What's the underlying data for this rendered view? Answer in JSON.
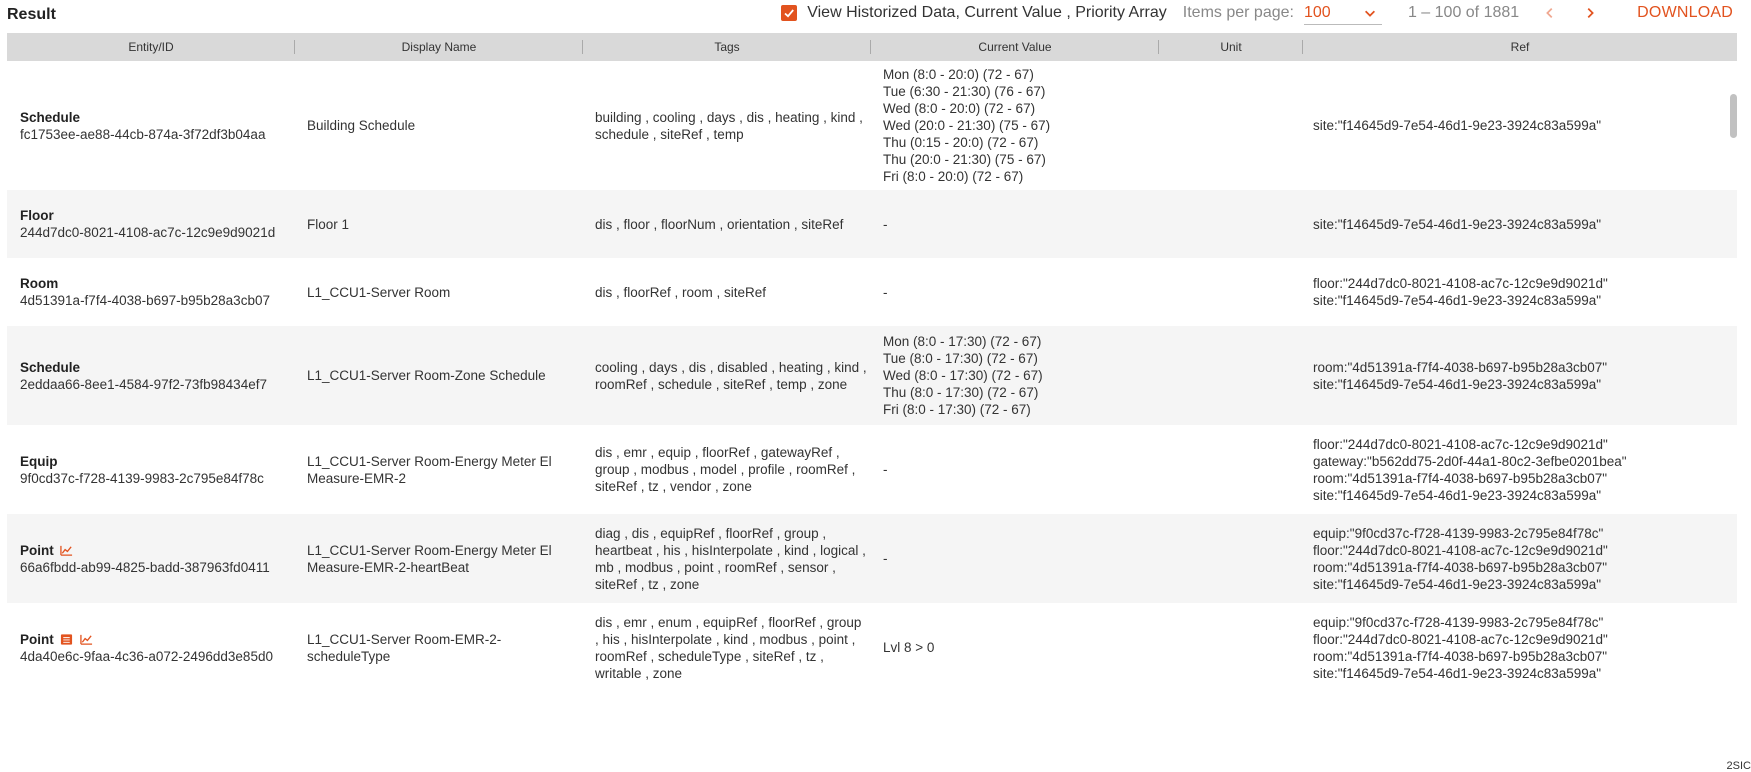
{
  "header": {
    "title": "Result",
    "historized_label": "View Historized Data, Current Value , Priority Array",
    "historized_checked": true,
    "items_per_page_label": "Items per page:",
    "items_per_page_value": "100",
    "range_text": "1 – 100 of 1881",
    "download_label": "DOWNLOAD",
    "accent_color": "#e2531f"
  },
  "table": {
    "columns": [
      "Entity/ID",
      "Display Name",
      "Tags",
      "Current Value",
      "Unit",
      "Ref"
    ],
    "rows": [
      {
        "type": "Schedule",
        "id": "fc1753ee-ae88-44cb-874a-3f72df3b04aa",
        "icons": [],
        "display": "Building Schedule",
        "tags": "building , cooling , days , dis , heating , kind , schedule , siteRef , temp",
        "current": [
          "Mon (8:0 - 20:0) (72 - 67)",
          "Tue (6:30 - 21:30) (76 - 67)",
          "Wed (8:0 - 20:0) (72 - 67)",
          "Wed (20:0 - 21:30) (75 - 67)",
          "Thu (0:15 - 20:0) (72 - 67)",
          "Thu (20:0 - 21:30) (75 - 67)",
          "Fri (8:0 - 20:0) (72 - 67)"
        ],
        "unit": "",
        "refs": [
          "site:\"f14645d9-7e54-46d1-9e23-3924c83a599a\""
        ]
      },
      {
        "type": "Floor",
        "id": "244d7dc0-8021-4108-ac7c-12c9e9d9021d",
        "icons": [],
        "display": "Floor 1",
        "tags": "dis , floor , floorNum , orientation , siteRef",
        "current": [
          "-"
        ],
        "unit": "",
        "refs": [
          "site:\"f14645d9-7e54-46d1-9e23-3924c83a599a\""
        ]
      },
      {
        "type": "Room",
        "id": "4d51391a-f7f4-4038-b697-b95b28a3cb07",
        "icons": [],
        "display": "L1_CCU1-Server Room",
        "tags": "dis , floorRef , room , siteRef",
        "current": [
          "-"
        ],
        "unit": "",
        "refs": [
          "floor:\"244d7dc0-8021-4108-ac7c-12c9e9d9021d\"",
          "site:\"f14645d9-7e54-46d1-9e23-3924c83a599a\""
        ]
      },
      {
        "type": "Schedule",
        "id": "2eddaa66-8ee1-4584-97f2-73fb98434ef7",
        "icons": [],
        "display": "L1_CCU1-Server Room-Zone Schedule",
        "tags": "cooling , days , dis , disabled , heating , kind , roomRef , schedule , siteRef , temp , zone",
        "current": [
          "Mon (8:0 - 17:30) (72 - 67)",
          "Tue (8:0 - 17:30) (72 - 67)",
          "Wed (8:0 - 17:30) (72 - 67)",
          "Thu (8:0 - 17:30) (72 - 67)",
          "Fri (8:0 - 17:30) (72 - 67)"
        ],
        "unit": "",
        "refs": [
          "room:\"4d51391a-f7f4-4038-b697-b95b28a3cb07\"",
          "site:\"f14645d9-7e54-46d1-9e23-3924c83a599a\""
        ]
      },
      {
        "type": "Equip",
        "id": "9f0cd37c-f728-4139-9983-2c795e84f78c",
        "icons": [],
        "display": "L1_CCU1-Server Room-Energy Meter El Measure-EMR-2",
        "tags": "dis , emr , equip , floorRef , gatewayRef , group , modbus , model , profile , roomRef , siteRef , tz , vendor , zone",
        "current": [
          "-"
        ],
        "unit": "",
        "refs": [
          "floor:\"244d7dc0-8021-4108-ac7c-12c9e9d9021d\"",
          "gateway:\"b562dd75-2d0f-44a1-80c2-3efbe0201bea\"",
          "room:\"4d51391a-f7f4-4038-b697-b95b28a3cb07\"",
          "site:\"f14645d9-7e54-46d1-9e23-3924c83a599a\""
        ]
      },
      {
        "type": "Point",
        "id": "66a6fbdd-ab99-4825-badd-387963fd0411",
        "icons": [
          "chart-icon"
        ],
        "display": "L1_CCU1-Server Room-Energy Meter El Measure-EMR-2-heartBeat",
        "tags": "diag , dis , equipRef , floorRef , group , heartbeat , his , hisInterpolate , kind , logical , mb , modbus , point , roomRef , sensor , siteRef , tz , zone",
        "current": [
          "-"
        ],
        "unit": "",
        "refs": [
          "equip:\"9f0cd37c-f728-4139-9983-2c795e84f78c\"",
          "floor:\"244d7dc0-8021-4108-ac7c-12c9e9d9021d\"",
          "room:\"4d51391a-f7f4-4038-b697-b95b28a3cb07\"",
          "site:\"f14645d9-7e54-46d1-9e23-3924c83a599a\""
        ]
      },
      {
        "type": "Point",
        "id": "4da40e6c-9faa-4c36-a072-2496dd3e85d0",
        "icons": [
          "list-icon",
          "chart-icon"
        ],
        "display": "L1_CCU1-Server Room-EMR-2-scheduleType",
        "tags": "dis , emr , enum , equipRef , floorRef , group , his , hisInterpolate , kind , modbus , point , roomRef , scheduleType , siteRef , tz , writable , zone",
        "current": [
          "Lvl 8 > 0"
        ],
        "unit": "",
        "refs": [
          "equip:\"9f0cd37c-f728-4139-9983-2c795e84f78c\"",
          "floor:\"244d7dc0-8021-4108-ac7c-12c9e9d9021d\"",
          "room:\"4d51391a-f7f4-4038-b697-b95b28a3cb07\"",
          "site:\"f14645d9-7e54-46d1-9e23-3924c83a599a\""
        ]
      }
    ]
  },
  "corner_text": "2SIC"
}
